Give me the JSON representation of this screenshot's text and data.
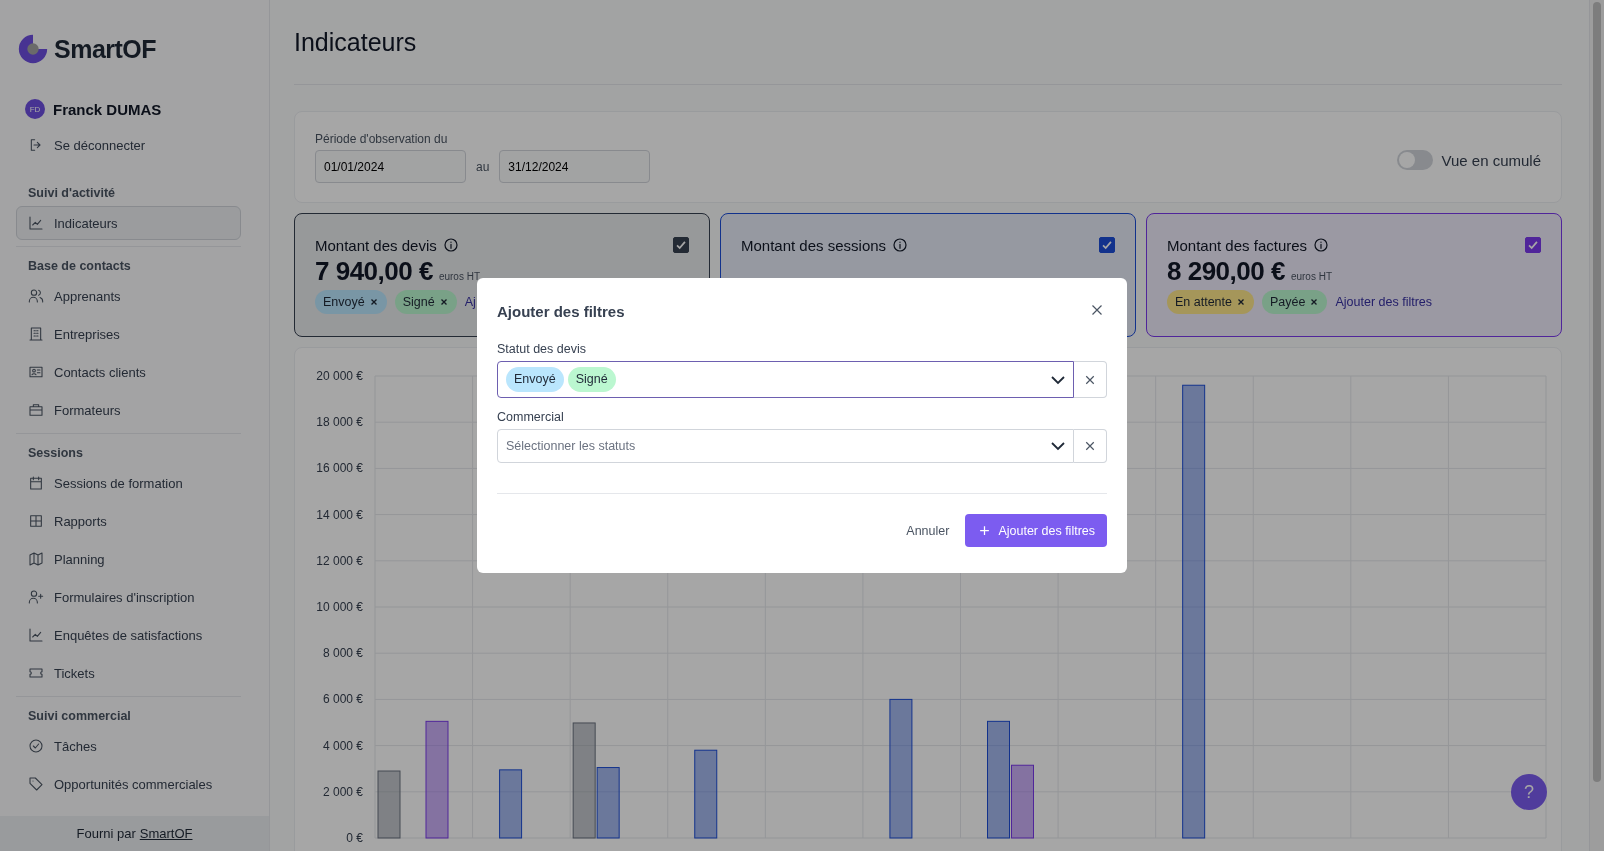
{
  "brand": {
    "name": "SmartOF"
  },
  "user": {
    "initials": "FD",
    "name": "Franck DUMAS",
    "logout": "Se déconnecter"
  },
  "sidebar": {
    "sections": [
      {
        "title": "Suivi d'activité",
        "items": [
          {
            "label": "Indicateurs",
            "selected": true
          }
        ]
      },
      {
        "title": "Base de contacts",
        "items": [
          {
            "label": "Apprenants",
            "selected": false
          },
          {
            "label": "Entreprises",
            "selected": false
          },
          {
            "label": "Contacts clients",
            "selected": false
          },
          {
            "label": "Formateurs",
            "selected": false
          }
        ]
      },
      {
        "title": "Sessions",
        "items": [
          {
            "label": "Sessions de formation",
            "selected": false
          },
          {
            "label": "Rapports",
            "selected": false
          },
          {
            "label": "Planning",
            "selected": false
          },
          {
            "label": "Formulaires d'inscription",
            "selected": false
          },
          {
            "label": "Enquêtes de satisfactions",
            "selected": false
          },
          {
            "label": "Tickets",
            "selected": false
          }
        ]
      },
      {
        "title": "Suivi commercial",
        "items": [
          {
            "label": "Tâches",
            "selected": false
          },
          {
            "label": "Opportunités commerciales",
            "selected": false
          }
        ]
      }
    ],
    "footer": {
      "text": "Fourni par",
      "link": "SmartOF"
    }
  },
  "page": {
    "title": "Indicateurs"
  },
  "period": {
    "label": "Période d'observation du",
    "from": "01/01/2024",
    "between": "au",
    "to": "31/12/2024",
    "toggle": {
      "label": "Vue en cumulé",
      "on": false
    }
  },
  "cards": [
    {
      "title": "Montant des devis",
      "amount": "7 940,00 €",
      "unit": "euros HT",
      "checked": true,
      "tags": [
        {
          "label": "Envoyé"
        },
        {
          "label": "Signé"
        }
      ],
      "link": "Aj"
    },
    {
      "title": "Montant des sessions",
      "checked": true
    },
    {
      "title": "Montant des factures",
      "amount": "8 290,00 €",
      "unit": "euros HT",
      "checked": true,
      "tags": [
        {
          "label": "En attente"
        },
        {
          "label": "Payée"
        }
      ],
      "link": "Ajouter des filtres"
    }
  ],
  "chart": {
    "chart_data": {
      "type": "bar",
      "ylim": [
        0,
        20000
      ],
      "grid": true,
      "yticks": [
        {
          "value": 0,
          "label": "0 €"
        },
        {
          "value": 2000,
          "label": "2 000 €"
        },
        {
          "value": 4000,
          "label": "4 000 €"
        },
        {
          "value": 6000,
          "label": "6 000 €"
        },
        {
          "value": 8000,
          "label": "8 000 €"
        },
        {
          "value": 10000,
          "label": "10 000 €"
        },
        {
          "value": 12000,
          "label": "12 000 €"
        },
        {
          "value": 14000,
          "label": "14 000 €"
        },
        {
          "value": 16000,
          "label": "16 000 €"
        },
        {
          "value": 18000,
          "label": "18 000 €"
        },
        {
          "value": 20000,
          "label": "20 000 €"
        }
      ],
      "series": [
        {
          "color": "#6b7280",
          "values": [
            2900,
            null,
            4980,
            null,
            null,
            null,
            null,
            null,
            null,
            null,
            null,
            null
          ]
        },
        {
          "color": "#1d4ed8",
          "values": [
            null,
            2950,
            3050,
            3800,
            null,
            6000,
            5050,
            null,
            19600,
            null,
            null,
            null
          ]
        },
        {
          "color": "#7c3aed",
          "values": [
            5050,
            null,
            null,
            null,
            null,
            null,
            3150,
            null,
            null,
            null,
            null,
            null
          ]
        }
      ]
    }
  },
  "help": {
    "label": "?"
  },
  "modal": {
    "title": "Ajouter des filtres",
    "fields": [
      {
        "label": "Statut des devis",
        "focused": true,
        "chips": [
          {
            "label": "Envoyé",
            "color": "#bae6fd"
          },
          {
            "label": "Signé",
            "color": "#bbf7d0"
          }
        ]
      },
      {
        "label": "Commercial",
        "focused": false,
        "placeholder": "Sélectionner les statuts"
      }
    ],
    "cancel": "Annuler",
    "submit": "Ajouter des filtres"
  }
}
